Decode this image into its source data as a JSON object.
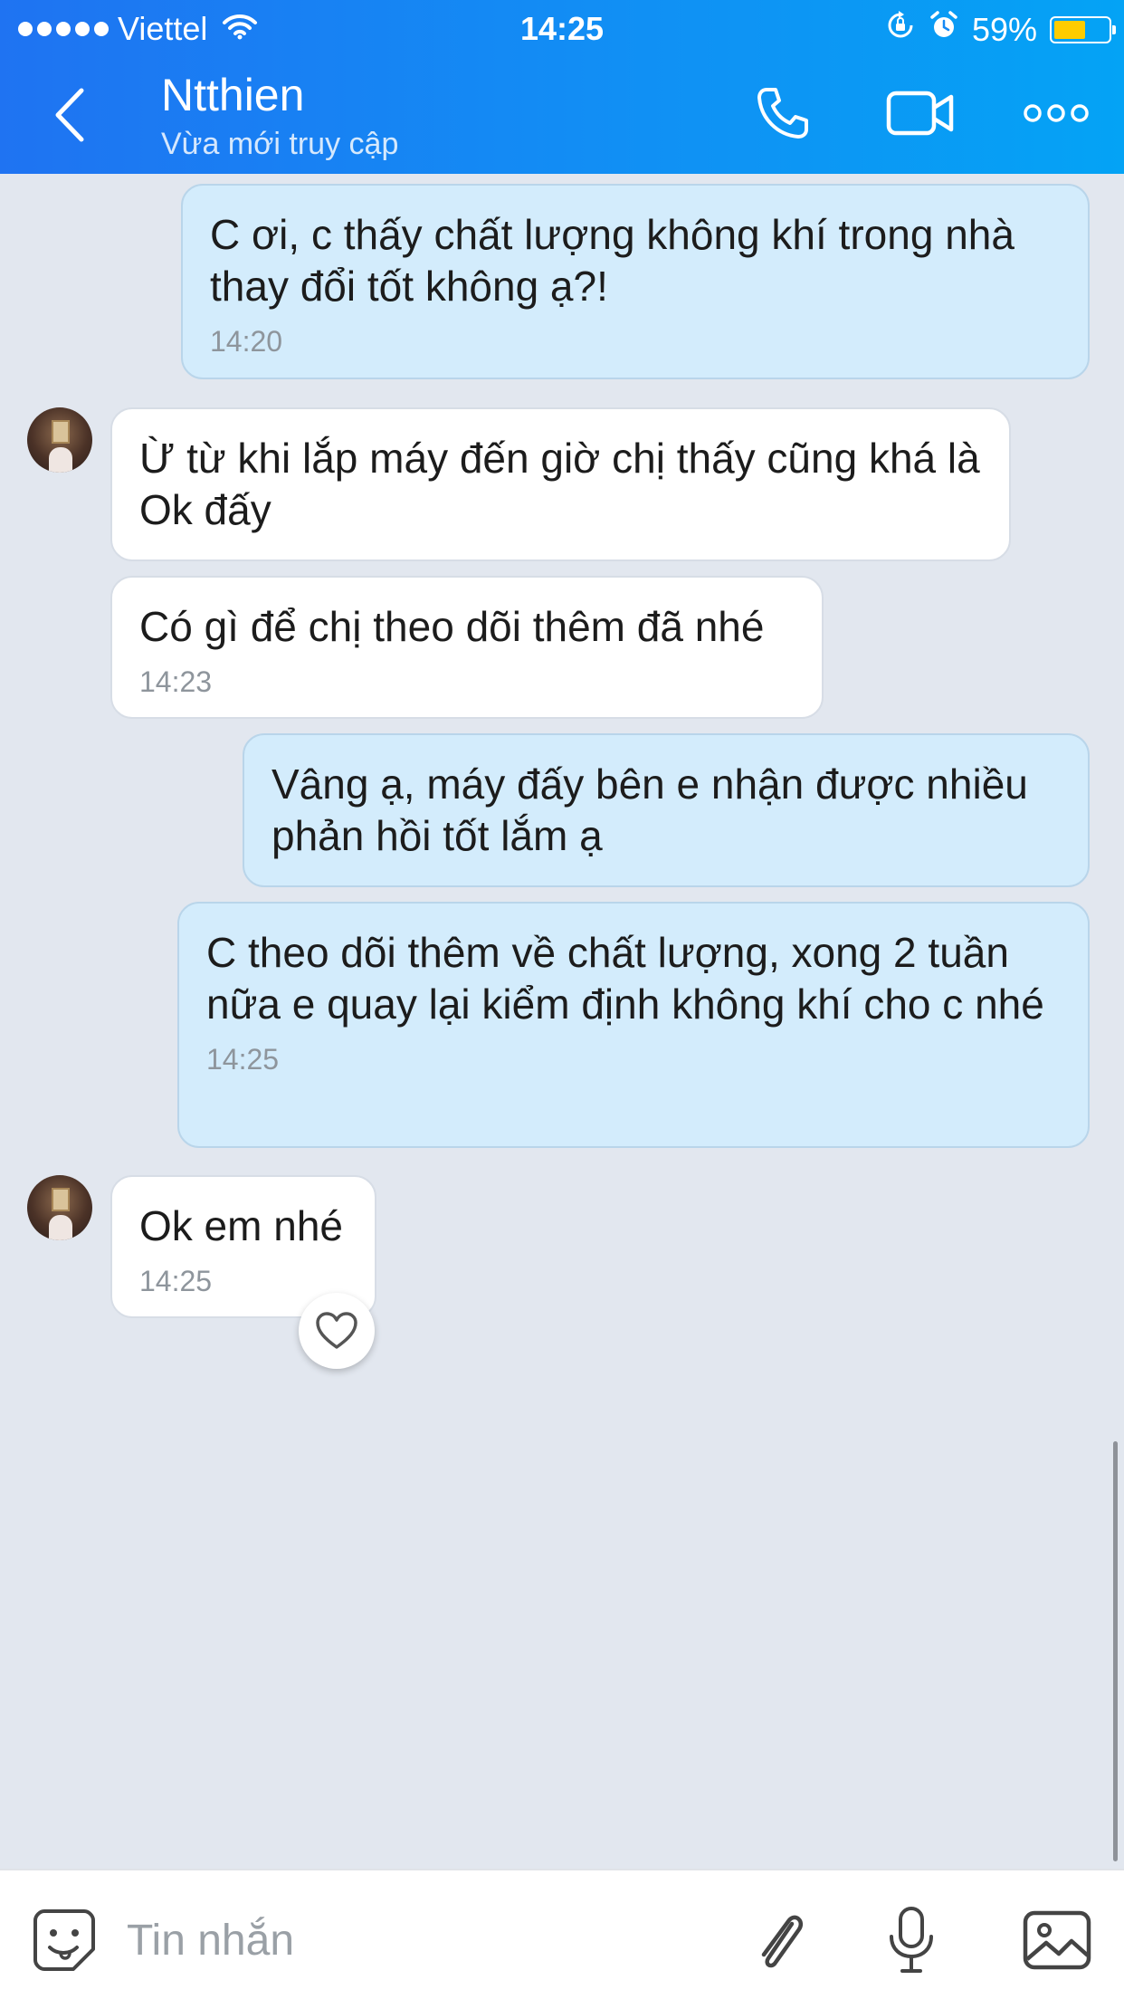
{
  "status_bar": {
    "carrier": "Viettel",
    "time": "14:25",
    "battery": "59%",
    "battery_level": 0.59,
    "icons": [
      "signal-dots",
      "wifi-icon",
      "rotation-lock-icon",
      "alarm-icon",
      "battery-icon"
    ]
  },
  "header": {
    "contact_name": "Ntthien",
    "contact_status": "Vừa mới truy cập",
    "icons": [
      "back-chevron-icon",
      "phone-icon",
      "video-camera-icon",
      "more-dots-icon"
    ]
  },
  "messages": [
    {
      "direction": "sent",
      "text": "C ơi, c thấy chất lượng không khí trong nhà thay đổi tốt không ạ?!",
      "time": "14:20"
    },
    {
      "direction": "received",
      "text": "Ừ từ khi lắp máy đến giờ chị thấy cũng khá là Ok đấy",
      "time": ""
    },
    {
      "direction": "received",
      "text": "Có gì để chị theo dõi thêm đã nhé",
      "time": "14:23"
    },
    {
      "direction": "sent",
      "text": "Vâng ạ, máy đấy bên e nhận được nhiều phản hồi tốt lắm ạ",
      "time": ""
    },
    {
      "direction": "sent",
      "text": "C theo dõi thêm về chất lượng, xong 2 tuần nữa e quay lại kiểm định không khí cho c nhé",
      "time": "14:25"
    },
    {
      "direction": "received",
      "text": "Ok em nhé",
      "time": "14:25"
    }
  ],
  "input_bar": {
    "placeholder": "Tin nhắn",
    "value": "",
    "icons": [
      "emoji-sticker-icon",
      "paperclip-icon",
      "microphone-icon",
      "image-icon"
    ]
  },
  "colors": {
    "header_gradient_start": "#1f73f2",
    "header_gradient_end": "#04a3f5",
    "sent_bubble": "#d3ecfc",
    "received_bubble": "#ffffff",
    "chat_background": "#e2e7ef",
    "battery": "#ffcc00"
  }
}
